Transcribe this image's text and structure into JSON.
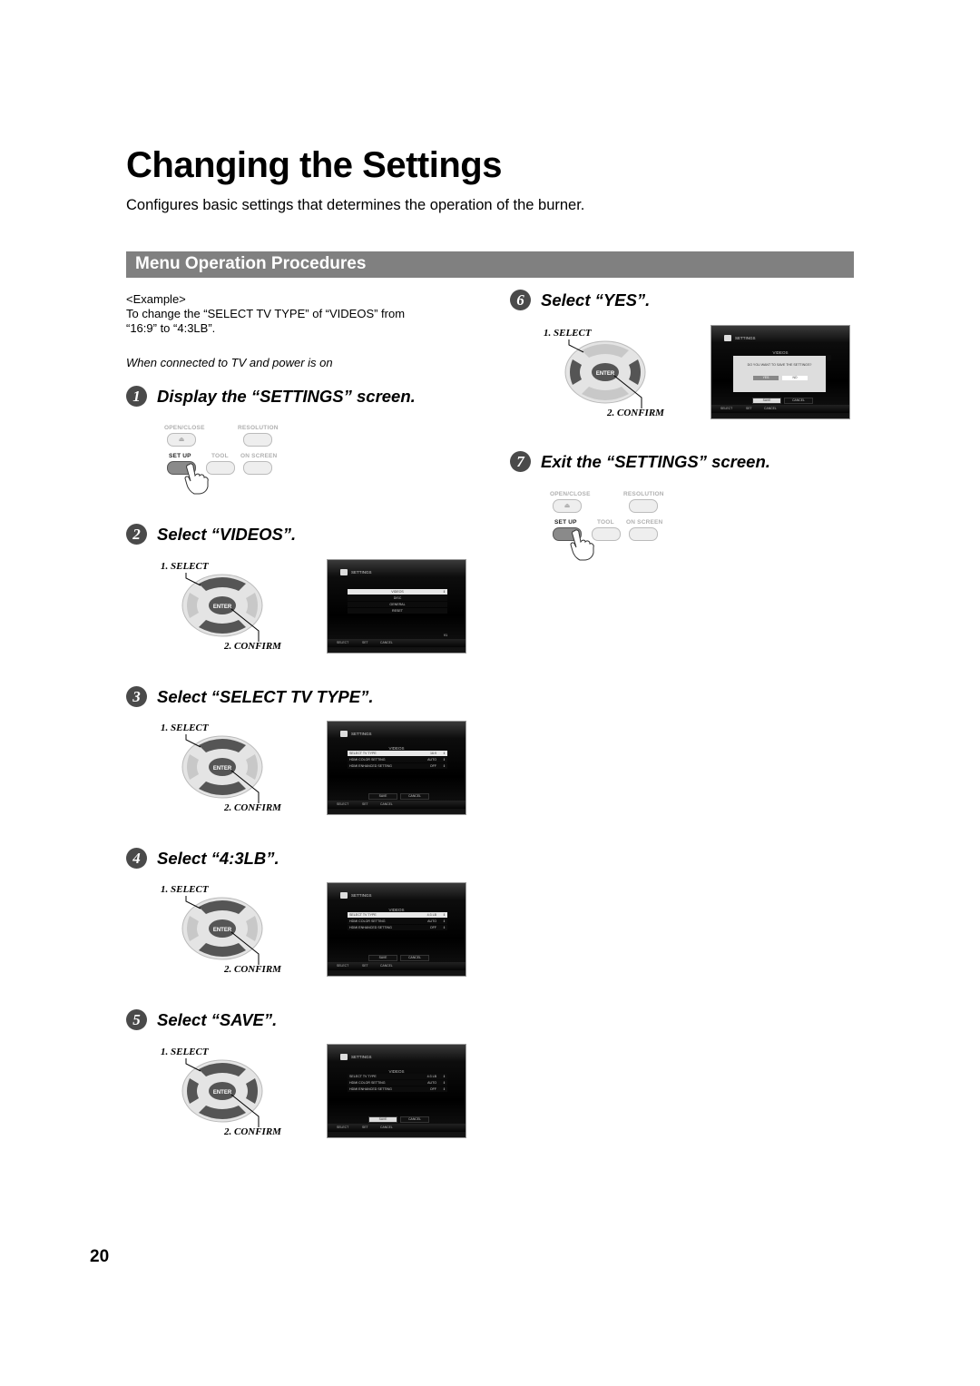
{
  "page": {
    "title": "Changing the Settings",
    "subtitle": "Configures basic settings that determines the operation of the burner.",
    "section_title": "Menu Operation Procedures",
    "page_number": "20",
    "accent_color": "#808080"
  },
  "intro": {
    "example_label": "<Example>",
    "example_line1": "To change the “SELECT TV TYPE” of “VIDEOS” from",
    "example_line2": "“16:9” to “4:3LB”.",
    "condition": "When connected to TV and power is on"
  },
  "remote_buttons": {
    "open_close": "OPEN/CLOSE",
    "resolution": "RESOLUTION",
    "set_up": "SET UP",
    "tool": "TOOL",
    "on_screen": "ON SCREEN",
    "eject_glyph": "⏏"
  },
  "dpad": {
    "select_caption": "1. SELECT",
    "confirm_caption": "2. CONFIRM",
    "enter_label": "ENTER",
    "up_glyph": "∧",
    "down_glyph": "∨",
    "left_glyph": "‹",
    "right_glyph": "›"
  },
  "tv": {
    "header": "SETTINGS",
    "menu_items": [
      "VIDEOS",
      "DISC",
      "GENERAL",
      "RESET"
    ],
    "videos_title": "VIDEOS",
    "rows": [
      {
        "key": "SELECT TV TYPE",
        "value_before": "16:9",
        "value_after": "4:3 LB"
      },
      {
        "key": "HDMI COLOR SETTING",
        "value": "AUTO"
      },
      {
        "key": "HDMI ENHANCED SETTING",
        "value": "OFF"
      }
    ],
    "save": "SAVE",
    "cancel": "CANCEL",
    "footer": {
      "select": "SELECT",
      "set": "SET",
      "cancel": "CANCEL"
    },
    "dialog_question": "DO YOU WANT TO SAVE THE SETTINGS?",
    "dialog_yes": "YES",
    "dialog_no": "NO",
    "version": "V1"
  },
  "steps": [
    {
      "num": "1",
      "title": "Display the “SETTINGS” screen."
    },
    {
      "num": "2",
      "title": "Select “VIDEOS”."
    },
    {
      "num": "3",
      "title": "Select “SELECT TV TYPE”."
    },
    {
      "num": "4",
      "title": "Select “4:3LB”."
    },
    {
      "num": "5",
      "title": "Select “SAVE”."
    },
    {
      "num": "6",
      "title": "Select “YES”."
    },
    {
      "num": "7",
      "title": "Exit the “SETTINGS” screen."
    }
  ]
}
